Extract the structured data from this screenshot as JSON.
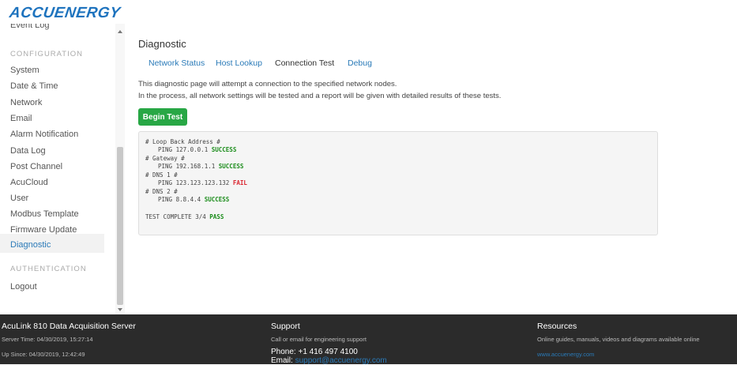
{
  "brand": {
    "logo_text": "ACCUENERGY"
  },
  "sidebar": {
    "partial_item": "Event Log",
    "sections": [
      {
        "label": "CONFIGURATION"
      },
      {
        "label": "AUTHENTICATION"
      }
    ],
    "config_items": [
      "System",
      "Date & Time",
      "Network",
      "Email",
      "Alarm Notification",
      "Data Log",
      "Post Channel",
      "AcuCloud",
      "User",
      "Modbus Template",
      "Firmware Update",
      "Diagnostic"
    ],
    "active_item": "Diagnostic",
    "auth_items": [
      "Logout"
    ]
  },
  "main": {
    "title": "Diagnostic",
    "tabs": [
      {
        "label": "Network Status"
      },
      {
        "label": "Host Lookup"
      },
      {
        "label": "Connection Test",
        "active": true
      },
      {
        "label": "Debug"
      }
    ],
    "description": [
      "This diagnostic page will attempt a connection to the specified network nodes.",
      "In the process, all network settings will be tested and a report will be given with detailed results of these tests."
    ],
    "begin_button": "Begin Test",
    "results": {
      "lines": [
        {
          "text": "# Loop Back Address #",
          "indent": false
        },
        {
          "text": "PING 127.0.0.1 ",
          "status": "SUCCESS",
          "indent": true
        },
        {
          "text": "# Gateway #",
          "indent": false
        },
        {
          "text": "PING 192.168.1.1 ",
          "status": "SUCCESS",
          "indent": true
        },
        {
          "text": "# DNS 1 #",
          "indent": false
        },
        {
          "text": "PING 123.123.123.132 ",
          "status": "FAIL",
          "indent": true
        },
        {
          "text": "# DNS 2 #",
          "indent": false
        },
        {
          "text": "PING 8.8.4.4 ",
          "status": "SUCCESS",
          "indent": true
        }
      ],
      "summary_text": "TEST COMPLETE 3/4 ",
      "summary_status": "PASS"
    }
  },
  "footer": {
    "col1": {
      "title": "AcuLink 810 Data Acquisition Server",
      "server_time": "Server Time: 04/30/2019, 15:27:14",
      "up_since": "Up Since: 04/30/2019, 12:42:49"
    },
    "col2": {
      "title": "Support",
      "text": "Call or email for engineering support",
      "phone": "Phone: +1 416 497 4100",
      "email_label": "Email:",
      "email": "support@accuenergy.com"
    },
    "col3": {
      "title": "Resources",
      "text": "Online guides, manuals, videos and diagrams available online",
      "link": "www.accuenergy.com"
    }
  },
  "colors": {
    "link": "#2a7ab8",
    "success": "#1a8c1a",
    "fail": "#d9232d",
    "button": "#28a745",
    "footer_bg": "#2b2b2b"
  }
}
